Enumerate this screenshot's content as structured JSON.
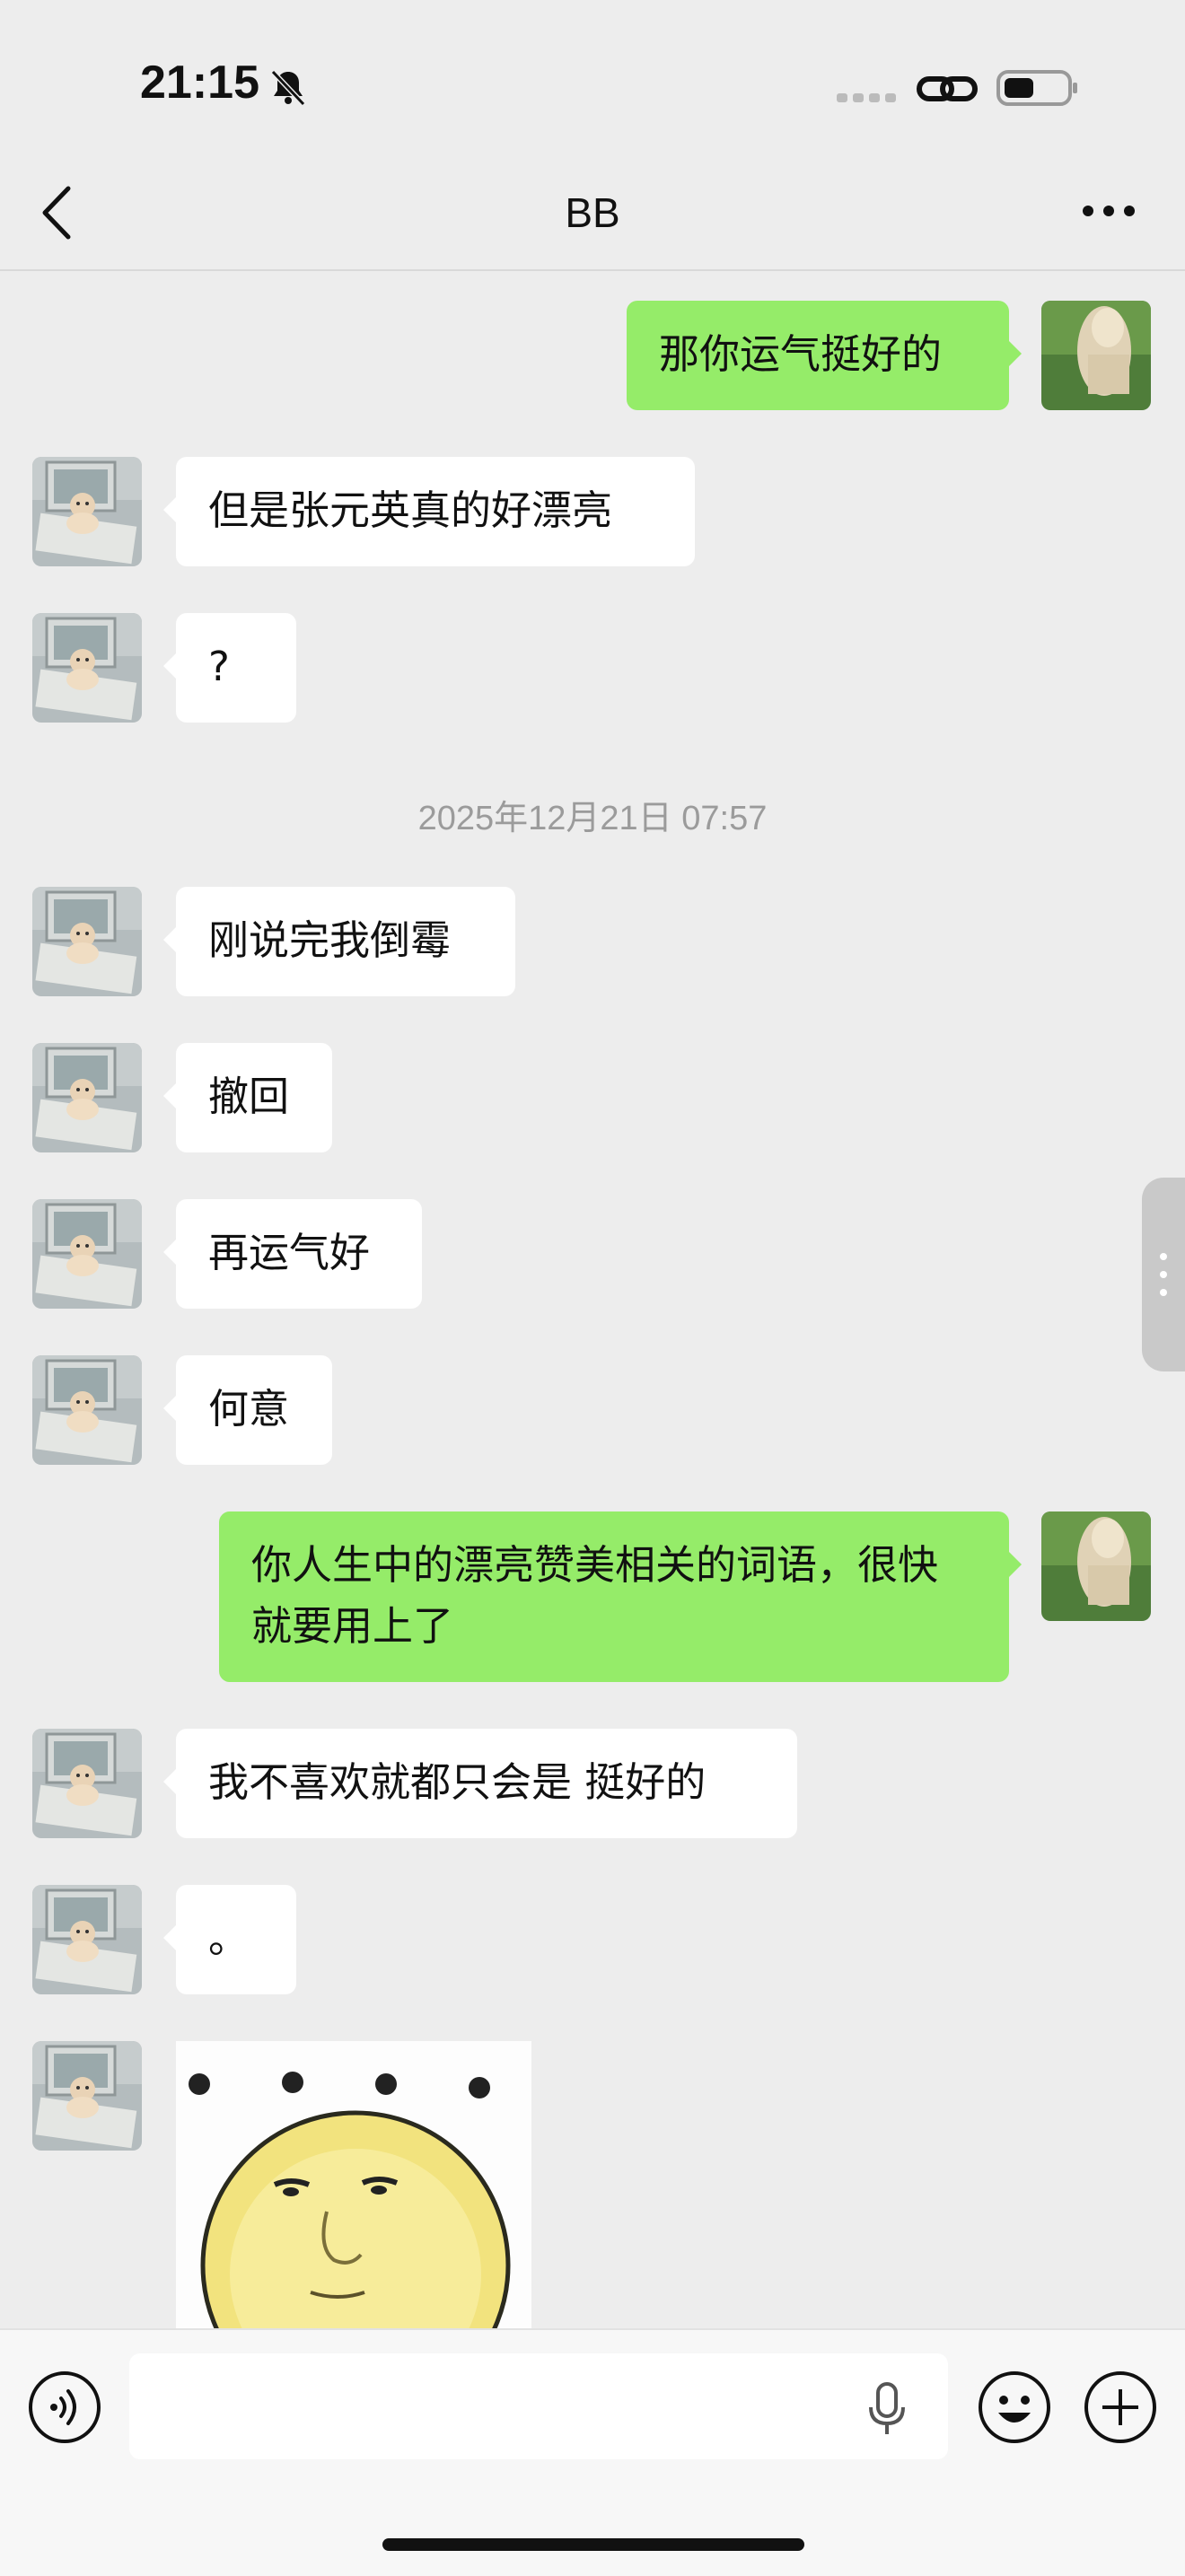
{
  "status_bar": {
    "time": "21:15",
    "icons": [
      "bell-slash-icon",
      "signal-icon",
      "link-icon",
      "battery-icon"
    ]
  },
  "nav": {
    "title": "BB",
    "icons": [
      "chevron-left-icon",
      "more-icon"
    ]
  },
  "messages": [
    {
      "side": "out",
      "text": "那你运气挺好的"
    },
    {
      "side": "in",
      "text": "但是张元英真的好漂亮"
    },
    {
      "side": "in",
      "text": "?"
    },
    {
      "timestamp": "2025年12月21日 07:57"
    },
    {
      "side": "in",
      "text": "刚说完我倒霉"
    },
    {
      "side": "in",
      "text": "撤回"
    },
    {
      "side": "in",
      "text": "再运气好"
    },
    {
      "side": "in",
      "text": "何意"
    },
    {
      "side": "out",
      "text": "你人生中的漂亮赞美相关的词语，很快就要用上了"
    },
    {
      "side": "in",
      "text": "我不喜欢就都只会是 挺好的"
    },
    {
      "side": "in",
      "text": "。"
    },
    {
      "side": "in",
      "sticker": "sticker-image"
    }
  ],
  "input_bar": {
    "value": "",
    "placeholder": "",
    "icons": [
      "voice-icon",
      "mic-icon",
      "emoji-icon",
      "plus-icon"
    ]
  },
  "colors": {
    "background": "#ededed",
    "outgoing_bubble": "#95ec69",
    "incoming_bubble": "#ffffff",
    "timestamp_text": "#9b9b9b"
  }
}
